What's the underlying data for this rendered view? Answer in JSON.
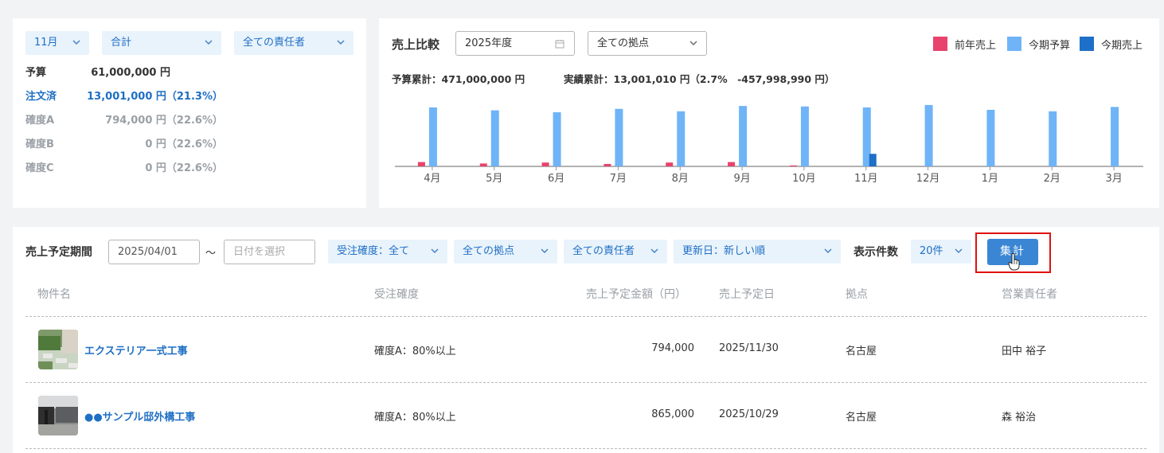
{
  "summary": {
    "month_select": "11月",
    "type_select": "合計",
    "person_select": "全ての責任者",
    "rows": [
      {
        "label": "予算",
        "value": "61,000,000 円"
      },
      {
        "label": "注文済",
        "value": "13,001,000 円（21.3%）"
      },
      {
        "label": "確度A",
        "value": "794,000 円（22.6%）"
      },
      {
        "label": "確度B",
        "value": "0 円（22.6%）"
      },
      {
        "label": "確度C",
        "value": "0 円（22.6%）"
      }
    ]
  },
  "chart_card": {
    "title": "売上比較",
    "year_select": "2025年度",
    "base_select": "全ての拠点",
    "budget_total": "予算累計：471,000,000 円",
    "actual_total": "実績累計：13,001,010 円（2.7%　-457,998,990 円）",
    "legend": [
      {
        "name": "前年売上",
        "color": "#e8436d"
      },
      {
        "name": "今期予算",
        "color": "#6fb4f7"
      },
      {
        "name": "今期売上",
        "color": "#1e6fc7"
      }
    ]
  },
  "chart_data": {
    "type": "bar",
    "categories": [
      "4月",
      "5月",
      "6月",
      "7月",
      "8月",
      "9月",
      "10月",
      "11月",
      "12月",
      "1月",
      "2月",
      "3月"
    ],
    "series": [
      {
        "name": "前年売上",
        "color": "#e8436d",
        "values": [
          4.5,
          3,
          4,
          2.5,
          4,
          4.5,
          1,
          0,
          0,
          0,
          0,
          0
        ]
      },
      {
        "name": "今期予算",
        "color": "#6fb4f7",
        "values": [
          61,
          58,
          56,
          59.5,
          57,
          62.5,
          62,
          61,
          63.5,
          58.5,
          57,
          61.5
        ]
      },
      {
        "name": "今期売上",
        "color": "#1e6fc7",
        "values": [
          0,
          0,
          0,
          0,
          0,
          0,
          0,
          13,
          0,
          0,
          0,
          0
        ]
      }
    ],
    "ylim": [
      0,
      70
    ]
  },
  "filters": {
    "period_label": "売上予定期間",
    "start_date": "2025/04/01",
    "tilde": "〜",
    "end_placeholder": "日付を選択",
    "certainty_select": "受注確度：全て",
    "base_select": "全ての拠点",
    "person_select": "全ての責任者",
    "sort_select": "更新日：新しい順",
    "count_label": "表示件数",
    "count_select": "20件",
    "aggregate_button": "集計"
  },
  "table": {
    "headers": [
      "物件名",
      "受注確度",
      "売上予定金額（円）",
      "売上予定日",
      "拠点",
      "営業責任者"
    ],
    "rows": [
      {
        "name": "エクステリア一式工事",
        "certainty": "確度A：80%以上",
        "amount": "794,000",
        "date": "2025/11/30",
        "base": "名古屋",
        "person": "田中 裕子"
      },
      {
        "name": "●●サンプル邸外構工事",
        "certainty": "確度A：80%以上",
        "amount": "865,000",
        "date": "2025/10/29",
        "base": "名古屋",
        "person": "森 裕治"
      }
    ]
  }
}
